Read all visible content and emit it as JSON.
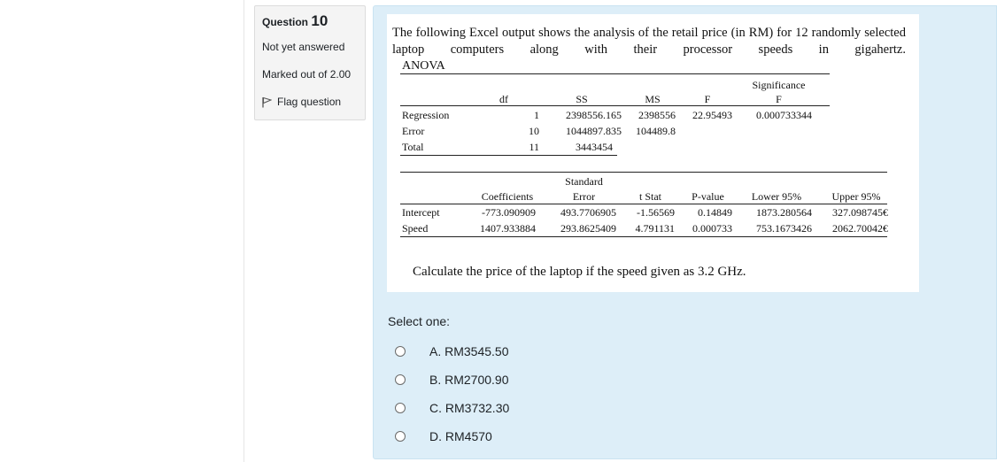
{
  "question": {
    "label": "Question",
    "number": "10",
    "state": "Not yet answered",
    "grade": "Marked out of 2.00",
    "flag_label": "Flag question"
  },
  "excel": {
    "intro": "The following Excel output shows the analysis of the retail price (in RM) for 12 randomly selected laptop computers along with their processor speeds in gigahertz.",
    "anova_title": "ANOVA",
    "anova_headers": [
      "df",
      "SS",
      "MS",
      "F",
      "Significance",
      "F"
    ],
    "anova_rows": [
      {
        "label": "Regression",
        "df": "1",
        "ss": "2398556.165",
        "ms": "2398556",
        "f": "22.95493",
        "sig": "0.000733344"
      },
      {
        "label": "Error",
        "df": "10",
        "ss": "1044897.835",
        "ms": "104489.8",
        "f": "",
        "sig": ""
      },
      {
        "label": "Total",
        "df": "11",
        "ss": "3443454",
        "ms": "",
        "f": "",
        "sig": ""
      }
    ],
    "coef_headers": [
      "Coefficients",
      "Standard",
      "Error",
      "t Stat",
      "P-value",
      "Lower 95%",
      "Upper 95%"
    ],
    "coef_rows": [
      {
        "label": "Intercept",
        "coef": "-773.090909",
        "se": "493.7706905",
        "t": "-1.56569",
        "p": "0.14849",
        "lower": "1873.280564",
        "upper": "327.098745€"
      },
      {
        "label": "Speed",
        "coef": "1407.933884",
        "se": "293.8625409",
        "t": "4.791131",
        "p": "0.000733",
        "lower": "753.1673426",
        "upper": "2062.70042€"
      }
    ],
    "prompt": "Calculate the price of the laptop if the speed given as 3.2 GHz."
  },
  "answer": {
    "select_label": "Select one:",
    "options": [
      "A. RM3545.50",
      "B. RM2700.90",
      "C. RM3732.30",
      "D. RM4570"
    ]
  }
}
